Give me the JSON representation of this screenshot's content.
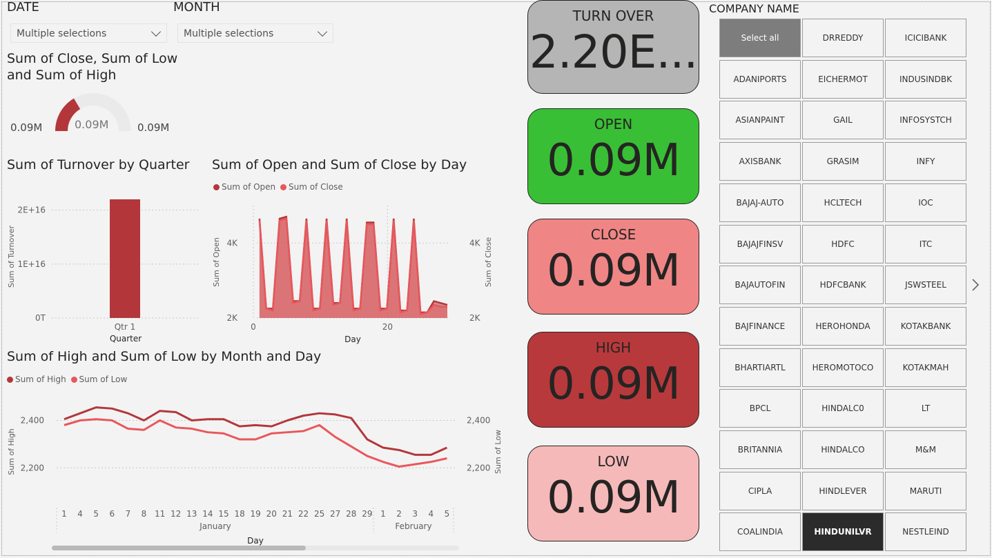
{
  "slicers": {
    "date": {
      "title": "DATE",
      "value": "Multiple selections"
    },
    "month": {
      "title": "MONTH",
      "value": "Multiple selections"
    }
  },
  "gauge": {
    "title_line1": "Sum of Close, Sum of Low",
    "title_line2": "and Sum of High",
    "min_label": "0.09M",
    "value_label": "0.09M",
    "max_label": "0.09M",
    "fill_fraction": 0.33
  },
  "colors": {
    "dark_red": "#b3373a",
    "light_red": "#e8575b",
    "gray_card": "#b5b5b5",
    "green_card": "#39bf35",
    "close_card": "#f08585",
    "high_card": "#b8393b",
    "low_card": "#f6b9b9"
  },
  "chart_data": [
    {
      "type": "bar",
      "title": "Sum of Turnover by Quarter",
      "xlabel": "Quarter",
      "ylabel": "Sum of Turnover",
      "categories": [
        "Qtr 1"
      ],
      "values": [
        2.2e+16
      ],
      "ylim": [
        0,
        2.2e+16
      ],
      "yticks": [
        "0T",
        "1E+16",
        "2E+16"
      ],
      "grid": true
    },
    {
      "type": "area",
      "title": "Sum of Open and Sum of Close by Day",
      "xlabel": "Day",
      "ylabel": "Sum of Open",
      "ylabel_right": "Sum of Close",
      "legend": [
        "Sum of Open",
        "Sum of Close"
      ],
      "xticks": [
        "0",
        "20"
      ],
      "yticks": [
        "2K",
        "4K"
      ],
      "yticks_right": [
        "2K",
        "4K"
      ],
      "ylim": [
        2000,
        5000
      ],
      "x": [
        1,
        2,
        3,
        4,
        5,
        6,
        7,
        8,
        9,
        10,
        11,
        12,
        13,
        14,
        15,
        16,
        17,
        18,
        19,
        20,
        21,
        22,
        23,
        24,
        25,
        26,
        27,
        28,
        29
      ],
      "series": [
        {
          "name": "Sum of Open",
          "values": [
            4650,
            2250,
            2250,
            4650,
            4700,
            2450,
            2450,
            4650,
            2250,
            2250,
            4650,
            2400,
            2400,
            4650,
            2250,
            2250,
            4550,
            4550,
            2250,
            2250,
            4650,
            2200,
            2200,
            4650,
            2150,
            2150,
            2450,
            2400,
            2350
          ]
        },
        {
          "name": "Sum of Close",
          "values": [
            4600,
            2250,
            2200,
            4600,
            4650,
            2400,
            2450,
            4600,
            2200,
            2250,
            4600,
            2350,
            2400,
            4600,
            2200,
            2250,
            4500,
            4500,
            2200,
            2250,
            4600,
            2150,
            2200,
            4600,
            2100,
            2150,
            2350,
            2300,
            2300
          ]
        }
      ]
    },
    {
      "type": "line",
      "title": "Sum of High and Sum of Low by Month and Day",
      "xlabel": "Day",
      "ylabel": "Sum of High",
      "ylabel_right": "Sum of Low",
      "legend": [
        "Sum of High",
        "Sum of Low"
      ],
      "x": [
        "1",
        "4",
        "5",
        "6",
        "7",
        "8",
        "11",
        "12",
        "13",
        "14",
        "15",
        "18",
        "19",
        "20",
        "21",
        "22",
        "25",
        "27",
        "28",
        "29",
        "1",
        "2",
        "3",
        "4",
        "5"
      ],
      "months": [
        "January",
        "February"
      ],
      "yticks": [
        "2,200",
        "2,400"
      ],
      "yticks_right": [
        "2,200",
        "2,400"
      ],
      "ylim": [
        2160,
        2480
      ],
      "series": [
        {
          "name": "Sum of High",
          "values": [
            2405,
            2430,
            2455,
            2450,
            2430,
            2400,
            2440,
            2435,
            2400,
            2405,
            2405,
            2375,
            2380,
            2375,
            2400,
            2420,
            2430,
            2425,
            2410,
            2320,
            2285,
            2275,
            2255,
            2255,
            2285
          ]
        },
        {
          "name": "Sum of Low",
          "values": [
            2380,
            2400,
            2405,
            2400,
            2365,
            2360,
            2400,
            2370,
            2365,
            2350,
            2345,
            2320,
            2320,
            2345,
            2350,
            2355,
            2380,
            2330,
            2290,
            2250,
            2225,
            2205,
            2215,
            2225,
            2240
          ]
        }
      ]
    }
  ],
  "cards": [
    {
      "label": "TURN OVER",
      "value": "2.20E..."
    },
    {
      "label": "OPEN",
      "value": "0.09M"
    },
    {
      "label": "CLOSE",
      "value": "0.09M"
    },
    {
      "label": "HIGH",
      "value": "0.09M"
    },
    {
      "label": "LOW",
      "value": "0.09M"
    }
  ],
  "company": {
    "title": "COMPANY NAME",
    "tiles": [
      "Select all",
      "DRREDDY",
      "ICICIBANK",
      "ADANIPORTS",
      "EICHERMOT",
      "INDUSINDBK",
      "ASIANPAINT",
      "GAIL",
      "INFOSYSTCH",
      "AXISBANK",
      "GRASIM",
      "INFY",
      "BAJAJ-AUTO",
      "HCLTECH",
      "IOC",
      "BAJAJFINSV",
      "HDFC",
      "ITC",
      "BAJAUTOFIN",
      "HDFCBANK",
      "JSWSTEEL",
      "BAJFINANCE",
      "HEROHONDA",
      "KOTAKBANK",
      "BHARTIARTL",
      "HEROMOTOCO",
      "KOTAKMAH",
      "BPCL",
      "HINDALC0",
      "LT",
      "BRITANNIA",
      "HINDALCO",
      "M&M",
      "CIPLA",
      "HINDLEVER",
      "MARUTI",
      "COALINDIA",
      "HINDUNILVR",
      "NESTLEIND"
    ],
    "selected": "HINDUNILVR",
    "next_icon": "chevron-right-icon"
  }
}
